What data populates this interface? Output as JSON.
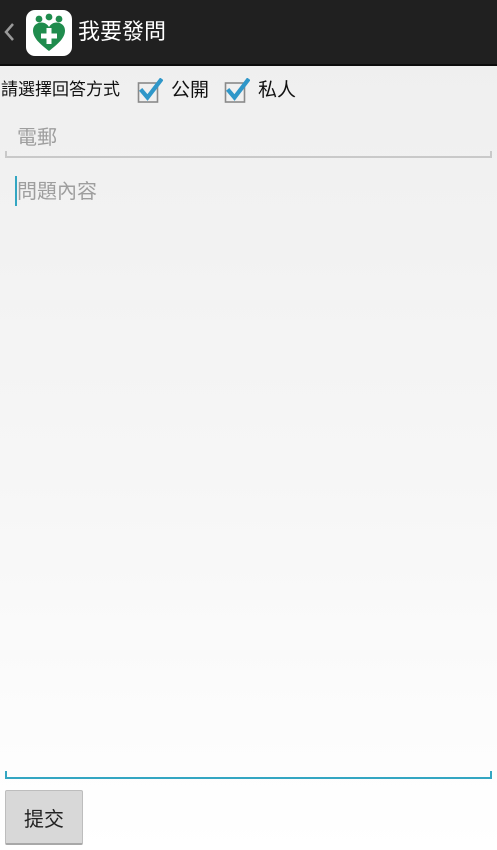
{
  "header": {
    "title": "我要發問",
    "back_icon": "chevron-left-icon",
    "app_icon": "medical-heart-people-icon"
  },
  "answer_mode": {
    "label": "請選擇回答方式",
    "options": [
      {
        "label": "公開",
        "checked": true
      },
      {
        "label": "私人",
        "checked": true
      }
    ]
  },
  "email": {
    "placeholder": "電郵",
    "value": ""
  },
  "question": {
    "placeholder": "問題內容",
    "value": ""
  },
  "submit": {
    "label": "提交"
  },
  "colors": {
    "action_bar": "#202020",
    "accent": "#33a6c2",
    "brand_green": "#1f8c4d",
    "checkbox_blue": "#2f97c9"
  }
}
